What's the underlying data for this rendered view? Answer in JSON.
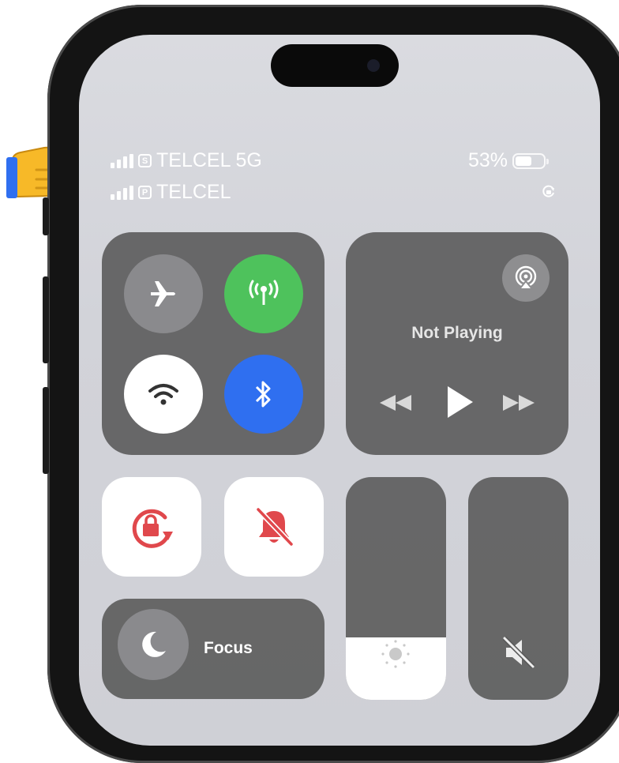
{
  "status_bar": {
    "line1_carrier": "TELCEL 5G",
    "line1_sim": "S",
    "line2_carrier": "TELCEL",
    "line2_sim": "P",
    "battery_percent": "53%",
    "battery_level": 0.53
  },
  "connectivity": {
    "airplane_mode": {
      "on": false,
      "icon": "airplane-icon"
    },
    "cellular_data": {
      "on": true,
      "color": "#4ec25c",
      "icon": "cellular-antenna-icon"
    },
    "wifi": {
      "on": true,
      "color": "#ffffff",
      "icon": "wifi-icon"
    },
    "bluetooth": {
      "on": true,
      "color": "#2f6ff0",
      "icon": "bluetooth-icon"
    }
  },
  "media": {
    "now_playing": "Not Playing",
    "icons": [
      "airplay-icon",
      "rewind-icon",
      "play-icon",
      "fast-forward-icon"
    ]
  },
  "controls": {
    "orientation_lock": {
      "on": true,
      "color": "#e0484c",
      "icon": "rotation-lock-icon"
    },
    "silent_mode": {
      "on": true,
      "color": "#e0484c",
      "icon": "bell-slash-icon"
    }
  },
  "focus": {
    "label": "Focus",
    "icon": "moon-icon"
  },
  "brightness": {
    "level": 0.28,
    "icon": "sun-icon"
  },
  "volume": {
    "level": 0.0,
    "icon": "speaker-muted-icon"
  }
}
